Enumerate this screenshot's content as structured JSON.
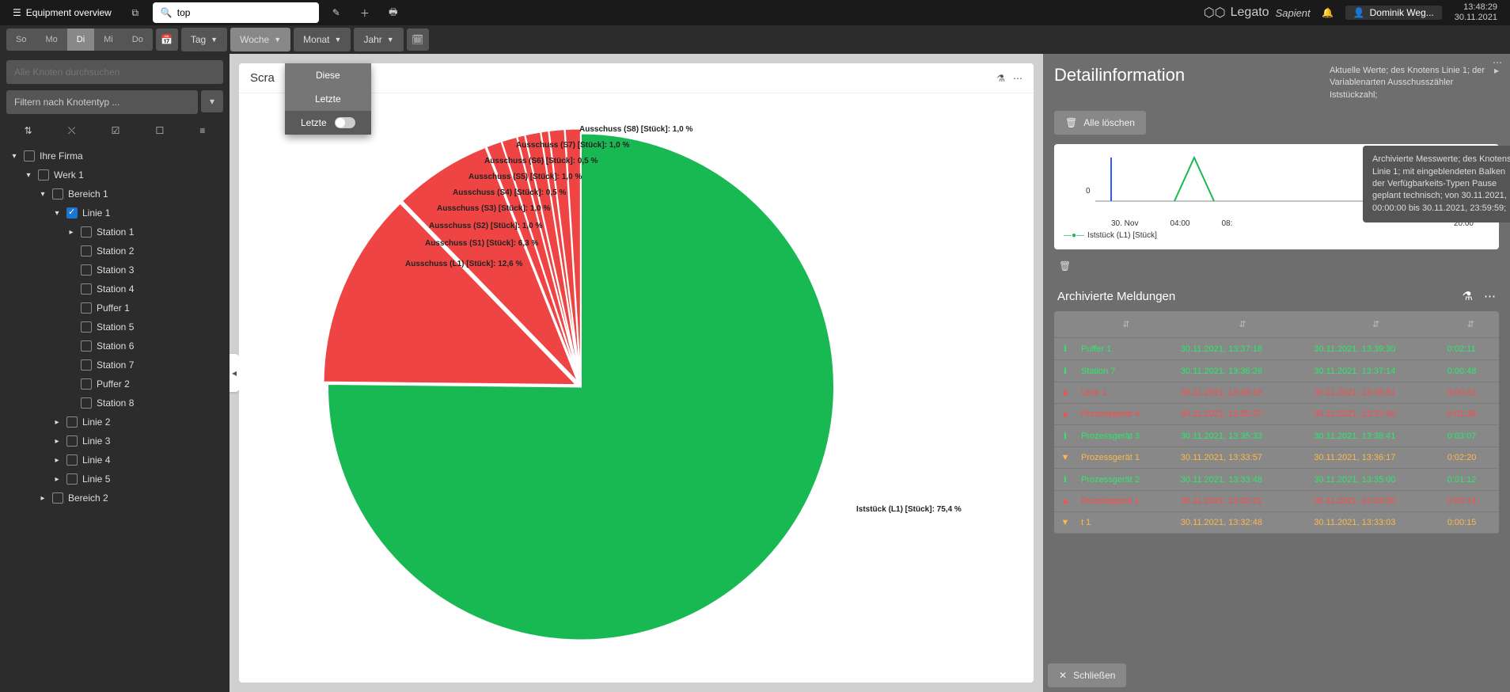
{
  "header": {
    "menu_label": "Equipment overview",
    "search_value": "top",
    "logo_text": "Legato",
    "logo_sub": "Sapient",
    "user_name": "Dominik Weg...",
    "time": "13:48:29",
    "date": "30.11.2021"
  },
  "toolbar": {
    "days": [
      "So",
      "Mo",
      "Di",
      "Mi",
      "Do"
    ],
    "day_active": 2,
    "periods": [
      {
        "label": "Tag",
        "open": false
      },
      {
        "label": "Woche",
        "open": true
      },
      {
        "label": "Monat",
        "open": false
      },
      {
        "label": "Jahr",
        "open": false
      }
    ],
    "dropdown_items": [
      "Diese",
      "Letzte",
      "Letzte"
    ]
  },
  "sidebar": {
    "search_placeholder": "Alle Knoten durchsuchen",
    "filter_placeholder": "Filtern nach Knotentyp ...",
    "tree": [
      {
        "indent": 0,
        "chev": "▾",
        "checked": false,
        "label": "Ihre Firma"
      },
      {
        "indent": 1,
        "chev": "▾",
        "checked": false,
        "label": "Werk 1"
      },
      {
        "indent": 2,
        "chev": "▾",
        "checked": false,
        "label": "Bereich 1"
      },
      {
        "indent": 3,
        "chev": "▾",
        "checked": true,
        "label": "Linie 1"
      },
      {
        "indent": 4,
        "chev": "▸",
        "checked": false,
        "label": "Station 1"
      },
      {
        "indent": 4,
        "chev": "",
        "checked": false,
        "label": "Station 2"
      },
      {
        "indent": 4,
        "chev": "",
        "checked": false,
        "label": "Station 3"
      },
      {
        "indent": 4,
        "chev": "",
        "checked": false,
        "label": "Station 4"
      },
      {
        "indent": 4,
        "chev": "",
        "checked": false,
        "label": "Puffer 1"
      },
      {
        "indent": 4,
        "chev": "",
        "checked": false,
        "label": "Station 5"
      },
      {
        "indent": 4,
        "chev": "",
        "checked": false,
        "label": "Station 6"
      },
      {
        "indent": 4,
        "chev": "",
        "checked": false,
        "label": "Station 7"
      },
      {
        "indent": 4,
        "chev": "",
        "checked": false,
        "label": "Puffer 2"
      },
      {
        "indent": 4,
        "chev": "",
        "checked": false,
        "label": "Station 8"
      },
      {
        "indent": 3,
        "chev": "▸",
        "checked": false,
        "label": "Linie 2"
      },
      {
        "indent": 3,
        "chev": "▸",
        "checked": false,
        "label": "Linie 3"
      },
      {
        "indent": 3,
        "chev": "▸",
        "checked": false,
        "label": "Linie 4"
      },
      {
        "indent": 3,
        "chev": "▸",
        "checked": false,
        "label": "Linie 5"
      },
      {
        "indent": 2,
        "chev": "▸",
        "checked": false,
        "label": "Bereich 2"
      }
    ]
  },
  "card": {
    "title": "Scra"
  },
  "chart_data": {
    "type": "pie",
    "title": "Scrap",
    "slices": [
      {
        "label": "Iststück (L1) [Stück]",
        "value": 75.4,
        "color": "#18b853"
      },
      {
        "label": "Ausschuss (L1) [Stück]",
        "value": 12.6,
        "color": "#ef4444"
      },
      {
        "label": "Ausschuss (S1) [Stück]",
        "value": 6.3,
        "color": "#ef4444"
      },
      {
        "label": "Ausschuss (S2) [Stück]",
        "value": 1.0,
        "color": "#ef4444"
      },
      {
        "label": "Ausschuss (S3) [Stück]",
        "value": 1.0,
        "color": "#ef4444"
      },
      {
        "label": "Ausschuss (S4) [Stück]",
        "value": 0.5,
        "color": "#ef4444"
      },
      {
        "label": "Ausschuss (S5) [Stück]",
        "value": 1.0,
        "color": "#ef4444"
      },
      {
        "label": "Ausschuss (S6) [Stück]",
        "value": 0.5,
        "color": "#ef4444"
      },
      {
        "label": "Ausschuss (S7) [Stück]",
        "value": 1.0,
        "color": "#ef4444"
      },
      {
        "label": "Ausschuss (S8) [Stück]",
        "value": 1.0,
        "color": "#ef4444"
      }
    ],
    "pull_index": 0
  },
  "detail": {
    "title": "Detailinformation",
    "subtitle": "Aktuelle Werte; des Knotens Linie 1; der Variablenarten Ausschusszähler Iststückzahl;",
    "clear_all": "Alle löschen",
    "mini_x": [
      "30. Nov",
      "04:00",
      "08:",
      "20:00"
    ],
    "mini_yzero": "0",
    "mini_legend": "Iststück (L1) [Stück]",
    "tooltip": "Archivierte Messwerte; des Knotens Linie 1; mit eingeblendeten Balken der Verfügbarkeits-Typen Pause geplant technisch; von 30.11.2021, 00:00:00 bis 30.11.2021, 23:59:59;",
    "archived_title": "Archivierte Meldungen",
    "close_label": "Schließen",
    "messages": [
      {
        "type": "info",
        "node": "Puffer 1",
        "from": "30.11.2021, 13:37:18",
        "to": "30.11.2021, 13:39:30",
        "dur": "0:02:11"
      },
      {
        "type": "info",
        "node": "Station 7",
        "from": "30.11.2021, 13:36:26",
        "to": "30.11.2021, 13:37:14",
        "dur": "0:00:48"
      },
      {
        "type": "err",
        "node": "Linie 1",
        "from": "30.11.2021, 13:36:19",
        "to": "30.11.2021, 13:36:51",
        "dur": "0:00:31"
      },
      {
        "type": "err",
        "node": "Prozessgerät 4",
        "from": "30.11.2021, 13:35:57",
        "to": "30.11.2021, 13:37:36",
        "dur": "0:01:38"
      },
      {
        "type": "info",
        "node": "Prozessgerät 3",
        "from": "30.11.2021, 13:35:33",
        "to": "30.11.2021, 13:38:41",
        "dur": "0:03:07"
      },
      {
        "type": "warn",
        "node": "Prozessgerät 1",
        "from": "30.11.2021, 13:33:57",
        "to": "30.11.2021, 13:36:17",
        "dur": "0:02:20"
      },
      {
        "type": "info",
        "node": "Prozessgerät 2",
        "from": "30.11.2021, 13:33:48",
        "to": "30.11.2021, 13:35:00",
        "dur": "0:01:12"
      },
      {
        "type": "err",
        "node": "Prozessgerät 1",
        "from": "30.11.2021, 13:33:21",
        "to": "30.11.2021, 13:33:35",
        "dur": "0:00:14"
      },
      {
        "type": "warn",
        "node": "t 1",
        "from": "30.11.2021, 13:32:48",
        "to": "30.11.2021, 13:33:03",
        "dur": "0:00:15"
      }
    ]
  }
}
